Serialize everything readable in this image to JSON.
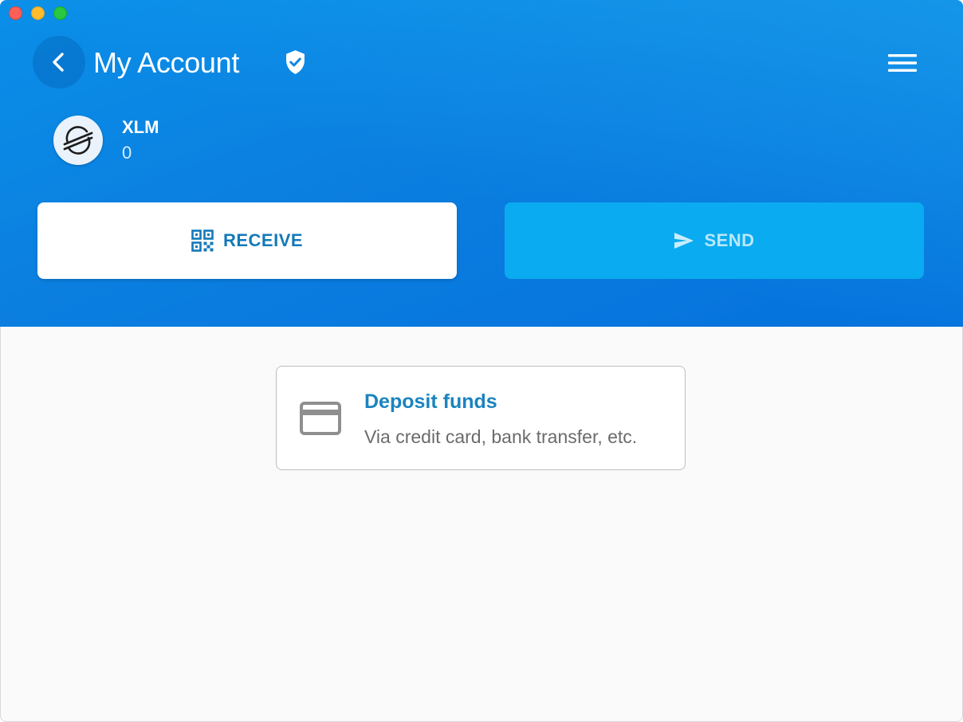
{
  "window": {
    "controls": [
      "close",
      "minimize",
      "maximize"
    ]
  },
  "header": {
    "title": "My Account",
    "back_icon": "chevron-left-icon",
    "verified_icon": "verified-shield-icon",
    "menu_icon": "hamburger-menu-icon"
  },
  "asset": {
    "code": "XLM",
    "balance": "0",
    "logo_icon": "stellar-logo-icon"
  },
  "actions": {
    "receive_label": "RECEIVE",
    "receive_icon": "qr-code-icon",
    "send_label": "SEND",
    "send_icon": "send-arrow-icon"
  },
  "deposit": {
    "title": "Deposit funds",
    "subtitle": "Via credit card, bank transfer, etc.",
    "icon": "credit-card-icon"
  },
  "colors": {
    "header_blue": "#0b7fe0",
    "accent_blue": "#1479b8",
    "send_button": "#0aabf0",
    "background": "#fafafa"
  }
}
